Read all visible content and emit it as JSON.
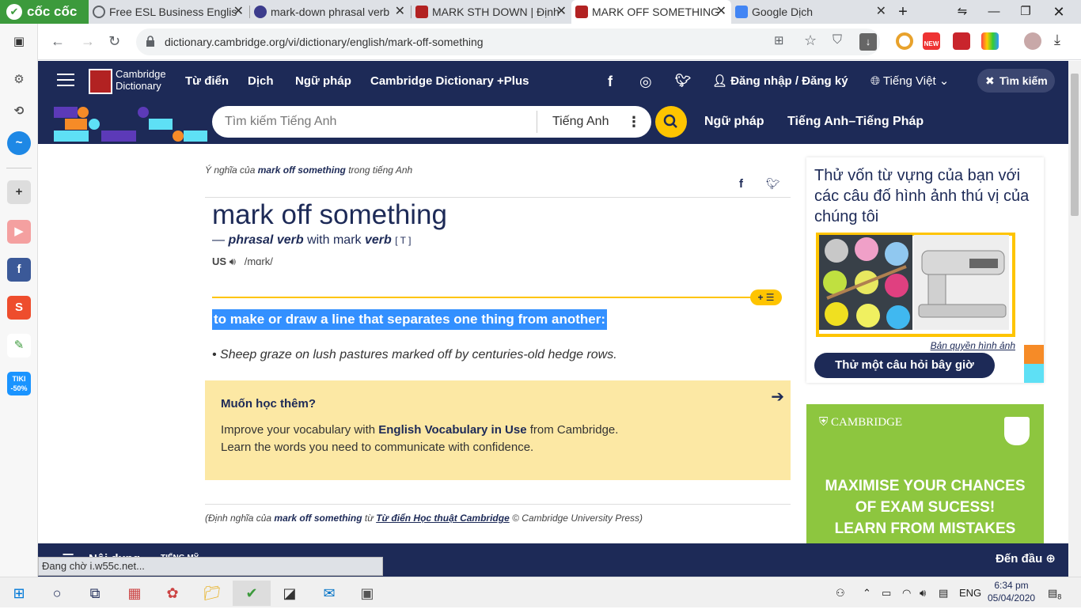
{
  "browser": {
    "brand": "cốc cốc",
    "tabs": [
      {
        "title": "Free ESL Business Englis",
        "color": "#5f6368"
      },
      {
        "title": "mark-down phrasal verb",
        "color": "#3c3c8c"
      },
      {
        "title": "MARK STH DOWN | Định",
        "color": "#b22222"
      },
      {
        "title": "MARK OFF SOMETHING",
        "color": "#b22222"
      },
      {
        "title": "Google Dịch",
        "color": "#4285f4"
      }
    ],
    "url": "dictionary.cambridge.org/vi/dictionary/english/mark-off-something",
    "new_badge": "NEW"
  },
  "site_nav": {
    "logo_line1": "Cambridge",
    "logo_line2": "Dictionary",
    "items": [
      "Từ điển",
      "Dịch",
      "Ngữ pháp",
      "Cambridge Dictionary +Plus"
    ],
    "login": "Đăng nhập / Đăng ký",
    "language": "Tiếng Việt",
    "search_toggle": "Tìm kiếm"
  },
  "search": {
    "placeholder": "Tìm kiếm Tiếng Anh",
    "lang": "Tiếng Anh",
    "link1": "Ngữ pháp",
    "link2": "Tiếng Anh–Tiếng Pháp"
  },
  "entry": {
    "crumb_prefix": "Ý nghĩa của",
    "crumb_word": "mark off something",
    "crumb_suffix": "trong tiếng Anh",
    "headword": "mark off something",
    "pos_dash": "—",
    "pos": "phrasal verb",
    "pos_with": "with mark",
    "pos_verb": "verb",
    "pos_code": "[ T ]",
    "region": "US",
    "ipa": "/mɑrk/",
    "badge": "+ ☰",
    "definition": "to make or draw a line that separates one thing from another:",
    "example": "Sheep graze on lush pastures marked off by centuries-old hedge rows.",
    "learn_title": "Muốn học thêm?",
    "learn_p1a": "Improve your vocabulary with",
    "learn_p1b": "English Vocabulary in Use",
    "learn_p1c": "from Cambridge.",
    "learn_p2": "Learn the words you need to communicate with confidence.",
    "src_prefix": "(Định nghĩa của",
    "src_word": "mark off something",
    "src_from": "từ",
    "src_link": "Từ điển Học thuật Cambridge",
    "src_suffix": "© Cambridge University Press)"
  },
  "sidebar_quiz": {
    "text": "Thử vốn từ vựng của bạn với các câu đố hình ảnh thú vị của chúng tôi",
    "copyright": "Bản quyền hình ảnh",
    "button": "Thử một câu hỏi bây giờ"
  },
  "ad": {
    "brand": "CAMBRIDGE",
    "line1": "MAXIMISE YOUR CHANCES",
    "line2": "OF EXAM SUCESS!",
    "line3": "LEARN FROM MISTAKES"
  },
  "footer": {
    "contents": "Nội dung",
    "dialect": "TIẾNG MỸ",
    "to_top": "Đến đầu"
  },
  "status_text": "Đang chờ i.w55c.net...",
  "taskbar": {
    "lang": "ENG",
    "time": "6:34 pm",
    "date": "05/04/2020",
    "notif": "8"
  },
  "side_apps": [
    {
      "name": "tiki",
      "label": "TIKI -50%"
    }
  ]
}
